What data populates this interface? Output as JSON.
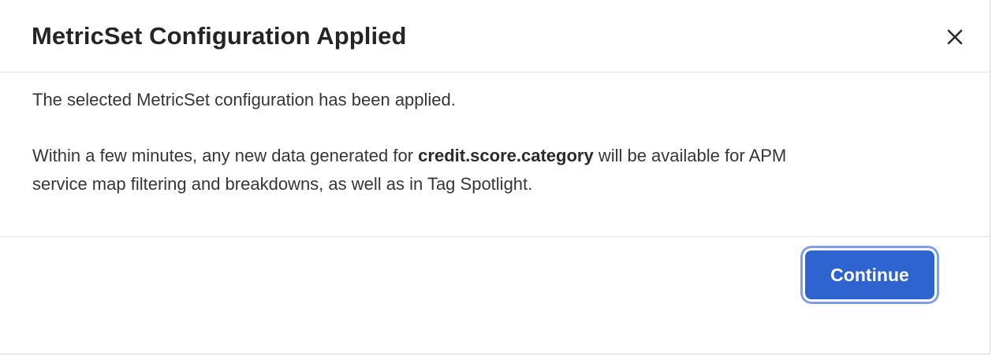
{
  "dialog": {
    "title": "MetricSet Configuration Applied",
    "close_icon": "close-icon",
    "message_1": "The selected MetricSet configuration has been applied.",
    "message_2_prefix": "Within a few minutes, any new data generated for ",
    "message_2_highlight": "credit.score.category",
    "message_2_suffix": " will be available for APM",
    "message_2_line2": "service map filtering and breakdowns, as well as in Tag Spotlight.",
    "continue_label": "Continue",
    "colors": {
      "primary_button": "#2f64d0",
      "focus_ring": "#7fa0e4"
    }
  }
}
